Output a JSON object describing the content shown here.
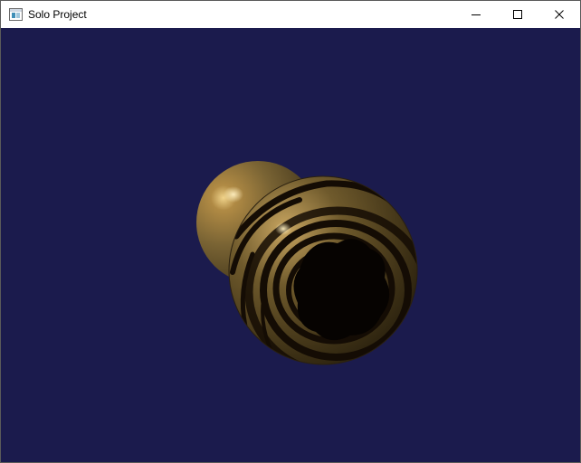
{
  "window": {
    "title": "Solo Project",
    "background_color": "#1b1b4d"
  },
  "titlebar": {
    "controls": [
      {
        "name": "minimize-icon"
      },
      {
        "name": "maximize-icon"
      },
      {
        "name": "close-icon"
      }
    ]
  },
  "scene": {
    "objects": [
      {
        "name": "plain-gold-sphere",
        "color": "#7a6434"
      },
      {
        "name": "striped-textured-sphere",
        "color": "#6f5a2c"
      }
    ]
  }
}
